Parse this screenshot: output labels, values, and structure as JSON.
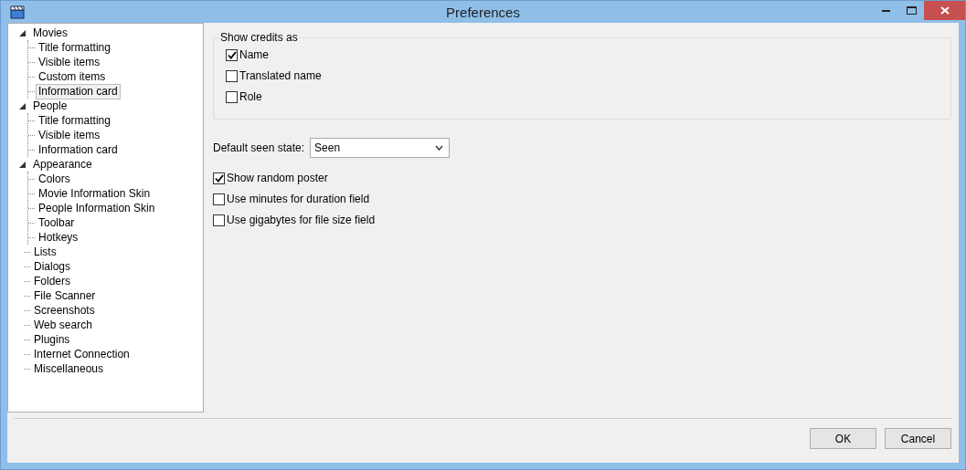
{
  "window": {
    "title": "Preferences"
  },
  "tree": [
    {
      "label": "Movies",
      "expanded": true,
      "selected": false,
      "children": [
        {
          "label": "Title formatting",
          "selected": false
        },
        {
          "label": "Visible items",
          "selected": false
        },
        {
          "label": "Custom items",
          "selected": false
        },
        {
          "label": "Information card",
          "selected": true
        }
      ]
    },
    {
      "label": "People",
      "expanded": true,
      "selected": false,
      "children": [
        {
          "label": "Title formatting",
          "selected": false
        },
        {
          "label": "Visible items",
          "selected": false
        },
        {
          "label": "Information card",
          "selected": false
        }
      ]
    },
    {
      "label": "Appearance",
      "expanded": true,
      "selected": false,
      "children": [
        {
          "label": "Colors",
          "selected": false
        },
        {
          "label": "Movie Information Skin",
          "selected": false
        },
        {
          "label": "People Information Skin",
          "selected": false
        },
        {
          "label": "Toolbar",
          "selected": false
        },
        {
          "label": "Hotkeys",
          "selected": false
        }
      ]
    },
    {
      "label": "Lists",
      "selected": false
    },
    {
      "label": "Dialogs",
      "selected": false
    },
    {
      "label": "Folders",
      "selected": false
    },
    {
      "label": "File Scanner",
      "selected": false
    },
    {
      "label": "Screenshots",
      "selected": false
    },
    {
      "label": "Web search",
      "selected": false
    },
    {
      "label": "Plugins",
      "selected": false
    },
    {
      "label": "Internet Connection",
      "selected": false
    },
    {
      "label": "Miscellaneous",
      "selected": false
    }
  ],
  "credits": {
    "title": "Show credits as",
    "options": [
      {
        "label": "Name",
        "checked": true
      },
      {
        "label": "Translated name",
        "checked": false
      },
      {
        "label": "Role",
        "checked": false
      }
    ]
  },
  "seen_state": {
    "label": "Default seen state:",
    "value": "Seen"
  },
  "options": [
    {
      "label": "Show random poster",
      "checked": true
    },
    {
      "label": "Use minutes for duration field",
      "checked": false
    },
    {
      "label": "Use gigabytes for file size field",
      "checked": false
    }
  ],
  "buttons": [
    "OK",
    "Cancel"
  ]
}
